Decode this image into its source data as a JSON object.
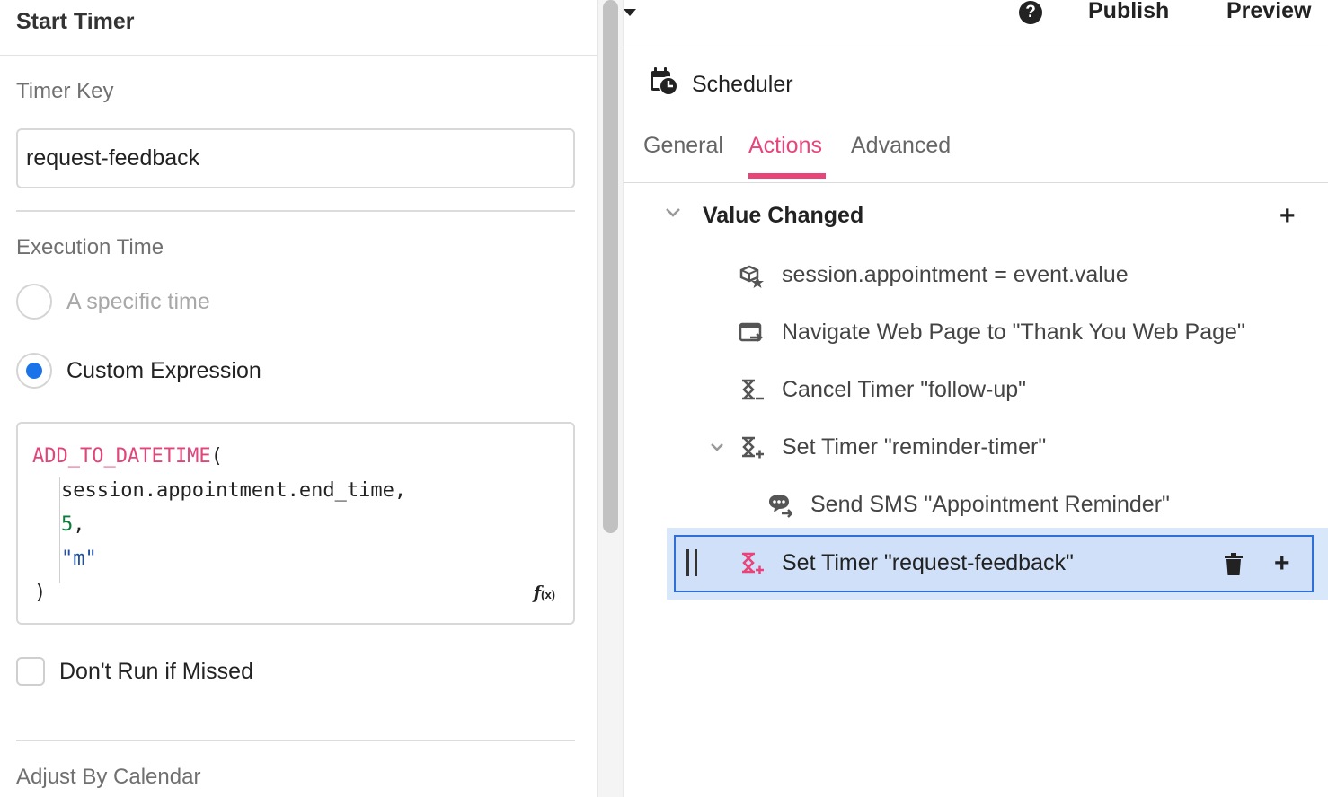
{
  "left_panel": {
    "title": "Start Timer",
    "timer_key_label": "Timer Key",
    "timer_key_value": "request-feedback",
    "execution_time_label": "Execution Time",
    "option_specific": "A specific time",
    "option_custom": "Custom Expression",
    "selected_option": "Custom Expression",
    "expression": {
      "fn_name": "ADD_TO_DATETIME",
      "open_paren": "(",
      "arg1": "session.appointment.end_time,",
      "arg2_num": "5",
      "arg2_comma": ",",
      "arg3_str": "\"m\"",
      "close_paren": ")"
    },
    "fx_icon": "function-icon",
    "dont_run_label": "Don't Run if Missed",
    "dont_run_checked": false,
    "adjust_label": "Adjust By Calendar"
  },
  "top_bar": {
    "dropdown_icon": "caret-down-icon",
    "help_icon": "help-icon",
    "help_glyph": "?",
    "publish_label": "Publish",
    "preview_label": "Preview"
  },
  "component": {
    "icon": "calendar-clock-icon",
    "name": "Scheduler"
  },
  "tabs": [
    {
      "label": "General",
      "active": false
    },
    {
      "label": "Actions",
      "active": true
    },
    {
      "label": "Advanced",
      "active": false
    }
  ],
  "event_group": {
    "title": "Value Changed",
    "expanded": true,
    "actions": [
      {
        "icon": "variable-star-icon",
        "label": "session.appointment = event.value"
      },
      {
        "icon": "navigate-page-icon",
        "label": "Navigate Web Page to \"Thank You Web Page\""
      },
      {
        "icon": "cancel-timer-icon",
        "label": "Cancel Timer \"follow-up\""
      },
      {
        "icon": "set-timer-icon",
        "label": "Set Timer \"reminder-timer\"",
        "expanded": true
      },
      {
        "icon": "send-sms-icon",
        "label": "Send SMS \"Appointment Reminder\"",
        "nested": true
      },
      {
        "icon": "set-timer-icon",
        "label": "Set Timer \"request-feedback\"",
        "selected": true
      }
    ]
  },
  "colors": {
    "accent": "#e8447a",
    "radio_selected": "#1a73e8",
    "selected_row_bg": "#d9e7fb",
    "selected_row_border": "#2f6fd6"
  }
}
